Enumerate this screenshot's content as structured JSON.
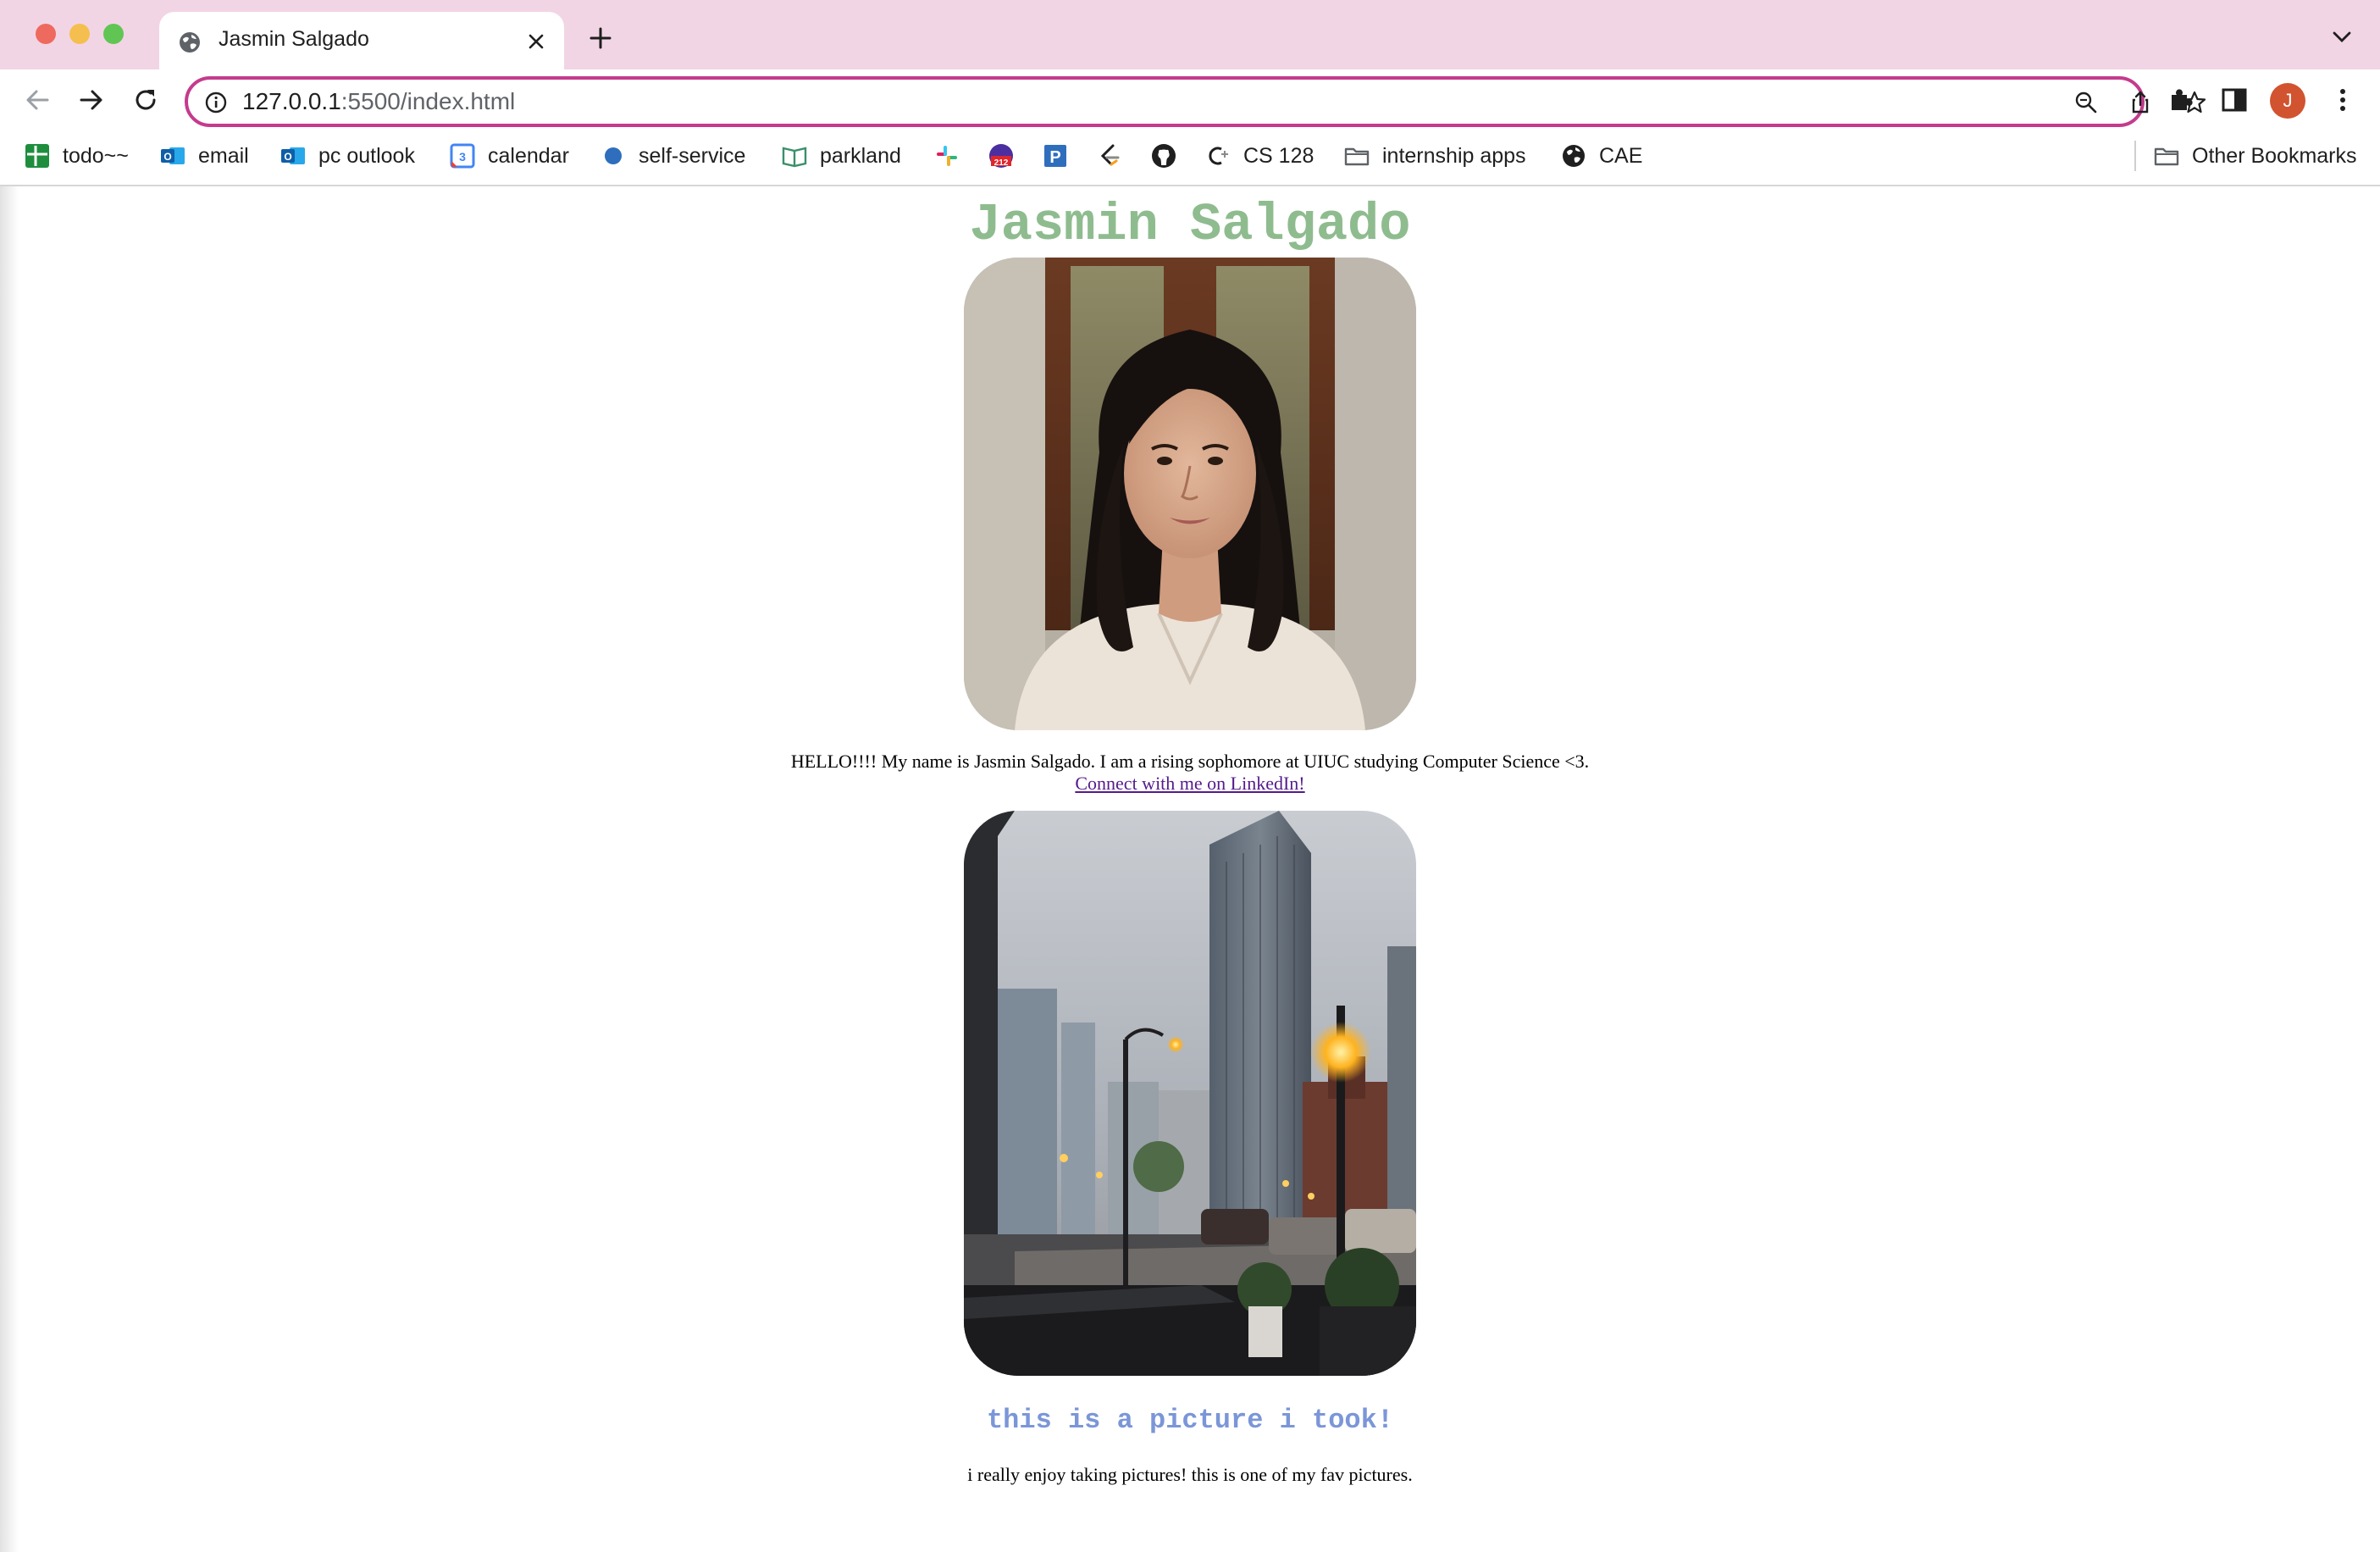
{
  "browser": {
    "tab_title": "Jasmin Salgado",
    "url_host": "127.0.0.1",
    "url_rest": ":5500/index.html",
    "profile_initial": "J",
    "accent_color": "#c43b8d",
    "tabbar_color": "#f2d5e4"
  },
  "bookmarks": [
    {
      "label": "todo~~",
      "icon": "sheets-icon"
    },
    {
      "label": "email",
      "icon": "outlook-icon"
    },
    {
      "label": "pc outlook",
      "icon": "outlook-icon"
    },
    {
      "label": "calendar",
      "icon": "calendar-icon"
    },
    {
      "label": "self-service",
      "icon": "blue-dot-icon"
    },
    {
      "label": "parkland",
      "icon": "book-icon"
    },
    {
      "label": "CS 128",
      "icon": "cs-icon"
    },
    {
      "label": "internship apps",
      "icon": "folder-icon"
    },
    {
      "label": "CAE",
      "icon": "globe-icon"
    }
  ],
  "other_bookmarks": "Other Bookmarks",
  "page": {
    "title": "Jasmin Salgado",
    "intro": "HELLO!!!! My name is Jasmin Salgado. I am a rising sophomore at UIUC studying Computer Science <3.",
    "linkedin_link": "Connect with me on LinkedIn!",
    "subheading": "this is a picture i took!",
    "caption": "i really enjoy taking pictures! this is one of my fav pictures.",
    "title_color": "#8fbc8f",
    "subheading_color": "#7b96d8"
  }
}
